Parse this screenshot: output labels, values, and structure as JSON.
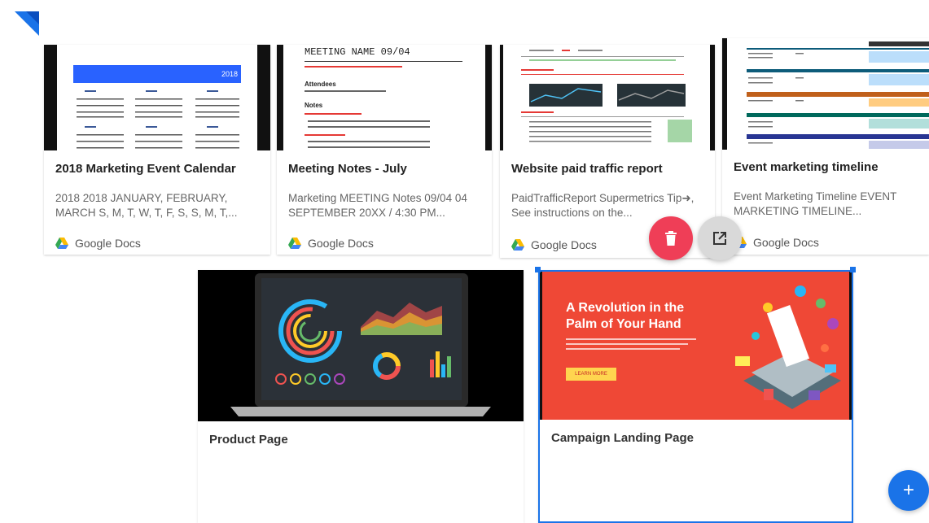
{
  "colors": {
    "accent": "#1a73e8",
    "delete": "#ef3e57",
    "external": "#d9d9d9",
    "fab": "#1a73e8"
  },
  "top_cards": [
    {
      "title": "2018 Marketing Event Calendar",
      "description": "2018 2018 JANUARY, FEBRUARY, MARCH S, M, T, W, T, F, S, S, M, T,...",
      "source": "Google Docs",
      "thumbnail": "calendar",
      "thumb_text": {
        "year": "2018"
      }
    },
    {
      "title": "Meeting Notes - July",
      "description": "Marketing MEETING Notes 09/04 04 SEPTEMBER 20XX / 4:30 PM...",
      "source": "Google Docs",
      "thumbnail": "meeting-notes",
      "thumb_text": {
        "heading": "MEETING NAME 09/04",
        "attendees": "Attendees",
        "notes": "Notes"
      }
    },
    {
      "title": "Website paid traffic report",
      "description": "PaidTrafficReport Supermetrics Tip➜, See instructions on the...",
      "source": "Google Docs",
      "thumbnail": "traffic-report"
    },
    {
      "title": "Event marketing timeline",
      "description": "Event Marketing Timeline EVENT MARKETING TIMELINE...",
      "source": "Google Docs",
      "thumbnail": "timeline"
    }
  ],
  "bottom_cards": [
    {
      "title": "Product Page",
      "thumbnail": "laptop-dashboard"
    },
    {
      "title": "Campaign Landing Page",
      "thumbnail": "campaign",
      "thumb_text": {
        "headline_1": "A Revolution in the",
        "headline_2": "Palm of Your Hand",
        "cta": "LEARN MORE"
      }
    }
  ],
  "actions": {
    "delete_icon": "trash-icon",
    "open_icon": "open-external-icon",
    "fab_label": "+"
  }
}
